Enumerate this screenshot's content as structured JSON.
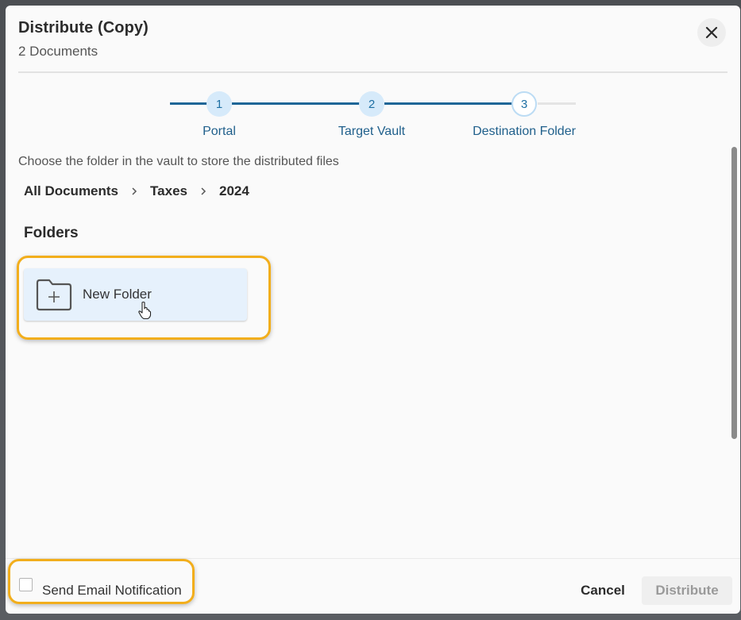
{
  "dialog": {
    "title": "Distribute (Copy)",
    "subtitle": "2 Documents",
    "close_icon": "close-icon"
  },
  "stepper": {
    "steps": [
      {
        "number": "1",
        "label": "Portal",
        "state": "complete"
      },
      {
        "number": "2",
        "label": "Target Vault",
        "state": "complete"
      },
      {
        "number": "3",
        "label": "Destination Folder",
        "state": "active"
      }
    ],
    "colors": {
      "line_complete": "#1e6697",
      "line_pending": "#e4e4e4",
      "circle_complete": "#d6eafa"
    }
  },
  "content": {
    "instructions": "Choose the folder in the vault to store the distributed files",
    "breadcrumb": [
      "All Documents",
      "Taxes",
      "2024"
    ],
    "folders_heading": "Folders",
    "new_folder_label": "New Folder",
    "new_folder_icon": "folder-plus-icon"
  },
  "footer": {
    "email_notification_label": "Send Email Notification",
    "email_notification_checked": false,
    "cancel_label": "Cancel",
    "distribute_label": "Distribute",
    "distribute_disabled": true
  },
  "colors": {
    "highlight": "#f2ae1c",
    "accent": "#1f5f8b",
    "card_background": "#e6f1fc"
  }
}
